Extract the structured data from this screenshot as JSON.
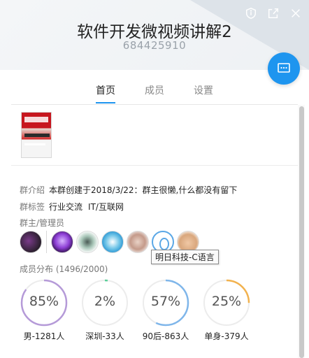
{
  "header": {
    "title": "软件开发微视频讲解2",
    "group_id": "684425910",
    "icons": [
      "shield-icon",
      "share-icon",
      "close-icon"
    ]
  },
  "tabs": [
    {
      "label": "首页",
      "active": true
    },
    {
      "label": "成员",
      "active": false
    },
    {
      "label": "设置",
      "active": false
    }
  ],
  "info": {
    "intro_label": "群介绍",
    "intro_text": "本群创建于2018/3/22：群主很懒,什么都没有留下",
    "tags_label": "群标签",
    "tags": [
      "行业交流",
      "IT/互联网"
    ],
    "admins_label": "群主/管理员",
    "tooltip": "明日科技-C语言"
  },
  "distribution": {
    "label": "成员分布 (1496/2000)",
    "stats": [
      {
        "percent": 85,
        "text": "85%",
        "label": "男-1281人",
        "color": "#b59ad8"
      },
      {
        "percent": 2,
        "text": "2%",
        "label": "深圳-33人",
        "color": "#5ccf9a"
      },
      {
        "percent": 57,
        "text": "57%",
        "label": "90后-863人",
        "color": "#7fb6ea"
      },
      {
        "percent": 25,
        "text": "25%",
        "label": "单身-379人",
        "color": "#f2b24e"
      }
    ]
  },
  "colors": {
    "accent": "#1e95ef"
  }
}
